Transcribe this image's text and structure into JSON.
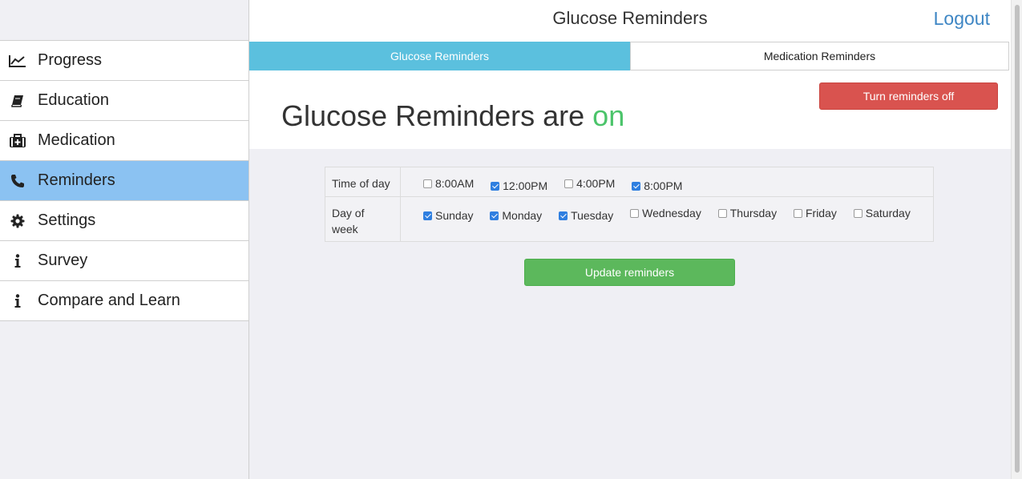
{
  "header": {
    "title": "Glucose Reminders",
    "logout_label": "Logout"
  },
  "sidebar": {
    "items": [
      {
        "label": "Progress",
        "icon": "line-chart-icon",
        "active": false
      },
      {
        "label": "Education",
        "icon": "book-icon",
        "active": false
      },
      {
        "label": "Medication",
        "icon": "medkit-icon",
        "active": false
      },
      {
        "label": "Reminders",
        "icon": "phone-icon",
        "active": true
      },
      {
        "label": "Settings",
        "icon": "gear-icon",
        "active": false
      },
      {
        "label": "Survey",
        "icon": "info-icon",
        "active": false
      },
      {
        "label": "Compare and Learn",
        "icon": "info-icon",
        "active": false
      }
    ]
  },
  "tabs": [
    {
      "label": "Glucose Reminders",
      "active": true
    },
    {
      "label": "Medication Reminders",
      "active": false
    }
  ],
  "status": {
    "prefix": "Glucose Reminders are ",
    "state": "on",
    "toggle_label": "Turn reminders off"
  },
  "schedule": {
    "time_label": "Time of day",
    "times": [
      {
        "label": "8:00AM",
        "checked": false
      },
      {
        "label": "12:00PM",
        "checked": true
      },
      {
        "label": "4:00PM",
        "checked": false
      },
      {
        "label": "8:00PM",
        "checked": true
      }
    ],
    "day_label": "Day of week",
    "days": [
      {
        "label": "Sunday",
        "checked": true
      },
      {
        "label": "Monday",
        "checked": true
      },
      {
        "label": "Tuesday",
        "checked": true
      },
      {
        "label": "Wednesday",
        "checked": false
      },
      {
        "label": "Thursday",
        "checked": false
      },
      {
        "label": "Friday",
        "checked": false
      },
      {
        "label": "Saturday",
        "checked": false
      }
    ]
  },
  "update_label": "Update reminders",
  "colors": {
    "active_nav": "#8bc2f2",
    "active_tab": "#5bc0de",
    "on_text": "#4bc46a",
    "danger": "#d9534f",
    "success": "#5cb85c",
    "link": "#3e86c4",
    "checkbox": "#2f7fe0"
  }
}
